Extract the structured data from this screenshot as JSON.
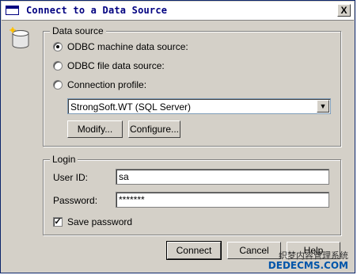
{
  "window": {
    "title": "Connect to a Data Source",
    "close_label": "X"
  },
  "data_source": {
    "legend": "Data source",
    "options": [
      {
        "label": "ODBC machine data source:",
        "checked": true
      },
      {
        "label": "ODBC file data source:",
        "checked": false
      },
      {
        "label": "Connection profile:",
        "checked": false
      }
    ],
    "profile_selected": "StrongSoft.WT (SQL Server)",
    "modify_label": "Modify...",
    "configure_label": "Configure..."
  },
  "login": {
    "legend": "Login",
    "user_id_label": "User ID:",
    "user_id_value": "sa",
    "password_label": "Password:",
    "password_value": "*******",
    "save_password_label": "Save password",
    "save_password_checked": true
  },
  "buttons": {
    "connect": "Connect",
    "cancel": "Cancel",
    "help": "Help"
  },
  "watermark": {
    "line1": "织梦内容管理系统",
    "line2": "DEDECMS.COM"
  },
  "colors": {
    "title_text": "#000080",
    "dialog_bg": "#d4d0c8"
  }
}
